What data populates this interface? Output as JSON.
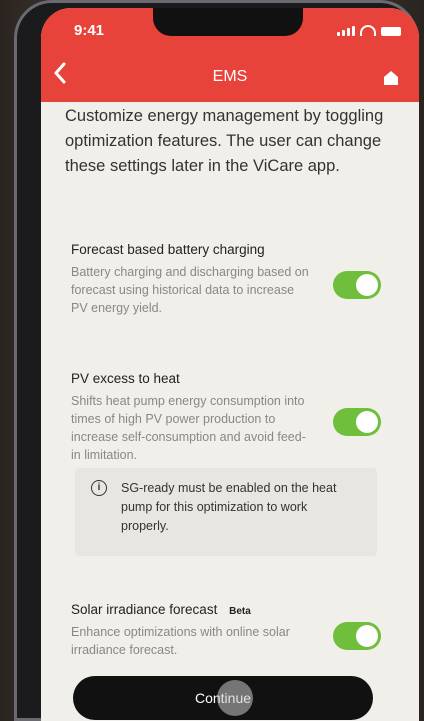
{
  "status": {
    "time": "9:41"
  },
  "nav": {
    "title": "EMS",
    "back_icon": "chevron-left-icon",
    "home_icon": "home-icon"
  },
  "intro": "Customize energy management by toggling optimization features. The user can change these settings later in the ViCare app.",
  "features": [
    {
      "title": "Forecast based battery charging",
      "description": "Battery charging and discharging based on forecast using historical data to increase PV energy yield.",
      "enabled": true
    },
    {
      "title": "PV excess to heat",
      "description": "Shifts heat pump energy consumption into times of high PV power production to increase self-consumption and avoid feed-in limitation.",
      "enabled": true
    },
    {
      "title": "Solar irradiance forecast",
      "badge": "Beta",
      "description": "Enhance optimizations with online solar irradiance forecast.",
      "enabled": true
    }
  ],
  "note": "SG-ready must be enabled on the heat pump for this optimization to work properly.",
  "continue_label": "Continue",
  "colors": {
    "header": "#e8433a",
    "toggle_on": "#6fbf3c",
    "background": "#f0efe9"
  }
}
